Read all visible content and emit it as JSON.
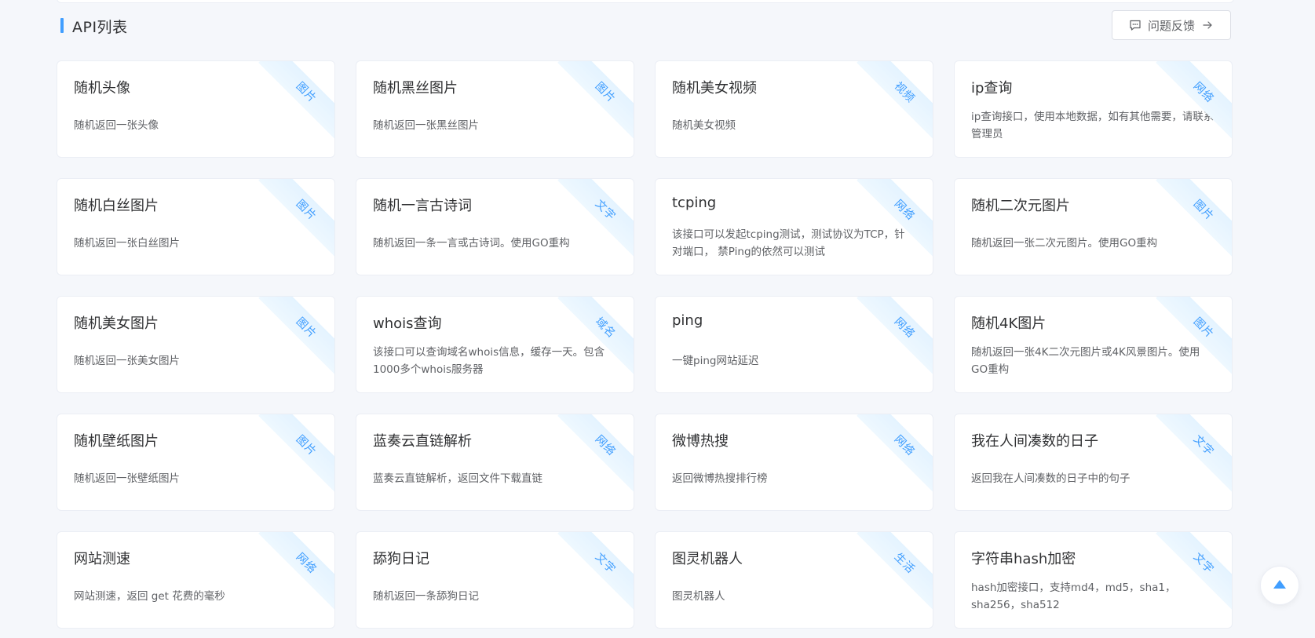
{
  "header": {
    "title": "API列表",
    "feedback_label": "问题反馈"
  },
  "colors": {
    "accent": "#409eff",
    "ribbon_bg": "#e4f3ff",
    "page_bg": "#f5f7fb"
  },
  "cards": [
    {
      "title": "随机头像",
      "desc": "随机返回一张头像",
      "tag": "图片"
    },
    {
      "title": "随机黑丝图片",
      "desc": "随机返回一张黑丝图片",
      "tag": "图片"
    },
    {
      "title": "随机美女视频",
      "desc": "随机美女视频",
      "tag": "视频"
    },
    {
      "title": "ip查询",
      "desc": "ip查询接口，使用本地数据，如有其他需要，请联系管理员",
      "tag": "网络"
    },
    {
      "title": "随机白丝图片",
      "desc": "随机返回一张白丝图片",
      "tag": "图片"
    },
    {
      "title": "随机一言古诗词",
      "desc": "随机返回一条一言或古诗词。使用GO重构",
      "tag": "文字"
    },
    {
      "title": "tcping",
      "desc": "该接口可以发起tcping测试，测试协议为TCP，针对端口， 禁Ping的依然可以测试",
      "tag": "网络"
    },
    {
      "title": "随机二次元图片",
      "desc": "随机返回一张二次元图片。使用GO重构",
      "tag": "图片"
    },
    {
      "title": "随机美女图片",
      "desc": "随机返回一张美女图片",
      "tag": "图片"
    },
    {
      "title": "whois查询",
      "desc": "该接口可以查询域名whois信息，缓存一天。包含1000多个whois服务器",
      "tag": "域名"
    },
    {
      "title": "ping",
      "desc": "一键ping网站延迟",
      "tag": "网络"
    },
    {
      "title": "随机4K图片",
      "desc": "随机返回一张4K二次元图片或4K风景图片。使用GO重构",
      "tag": "图片"
    },
    {
      "title": "随机壁纸图片",
      "desc": "随机返回一张壁纸图片",
      "tag": "图片"
    },
    {
      "title": "蓝奏云直链解析",
      "desc": "蓝奏云直链解析，返回文件下载直链",
      "tag": "网络"
    },
    {
      "title": "微博热搜",
      "desc": "返回微博热搜排行榜",
      "tag": "网络"
    },
    {
      "title": "我在人间凑数的日子",
      "desc": "返回我在人间凑数的日子中的句子",
      "tag": "文字"
    },
    {
      "title": "网站测速",
      "desc": "网站测速，返回 get 花费的毫秒",
      "tag": "网络"
    },
    {
      "title": "舔狗日记",
      "desc": "随机返回一条舔狗日记",
      "tag": "文字"
    },
    {
      "title": "图灵机器人",
      "desc": "图灵机器人",
      "tag": "生活"
    },
    {
      "title": "字符串hash加密",
      "desc": "hash加密接口，支持md4，md5，sha1，sha256，sha512",
      "tag": "文字"
    }
  ],
  "icons": {
    "feedback": "chat-icon",
    "arrow": "arrow-right-icon",
    "back_top": "caret-up-icon"
  }
}
